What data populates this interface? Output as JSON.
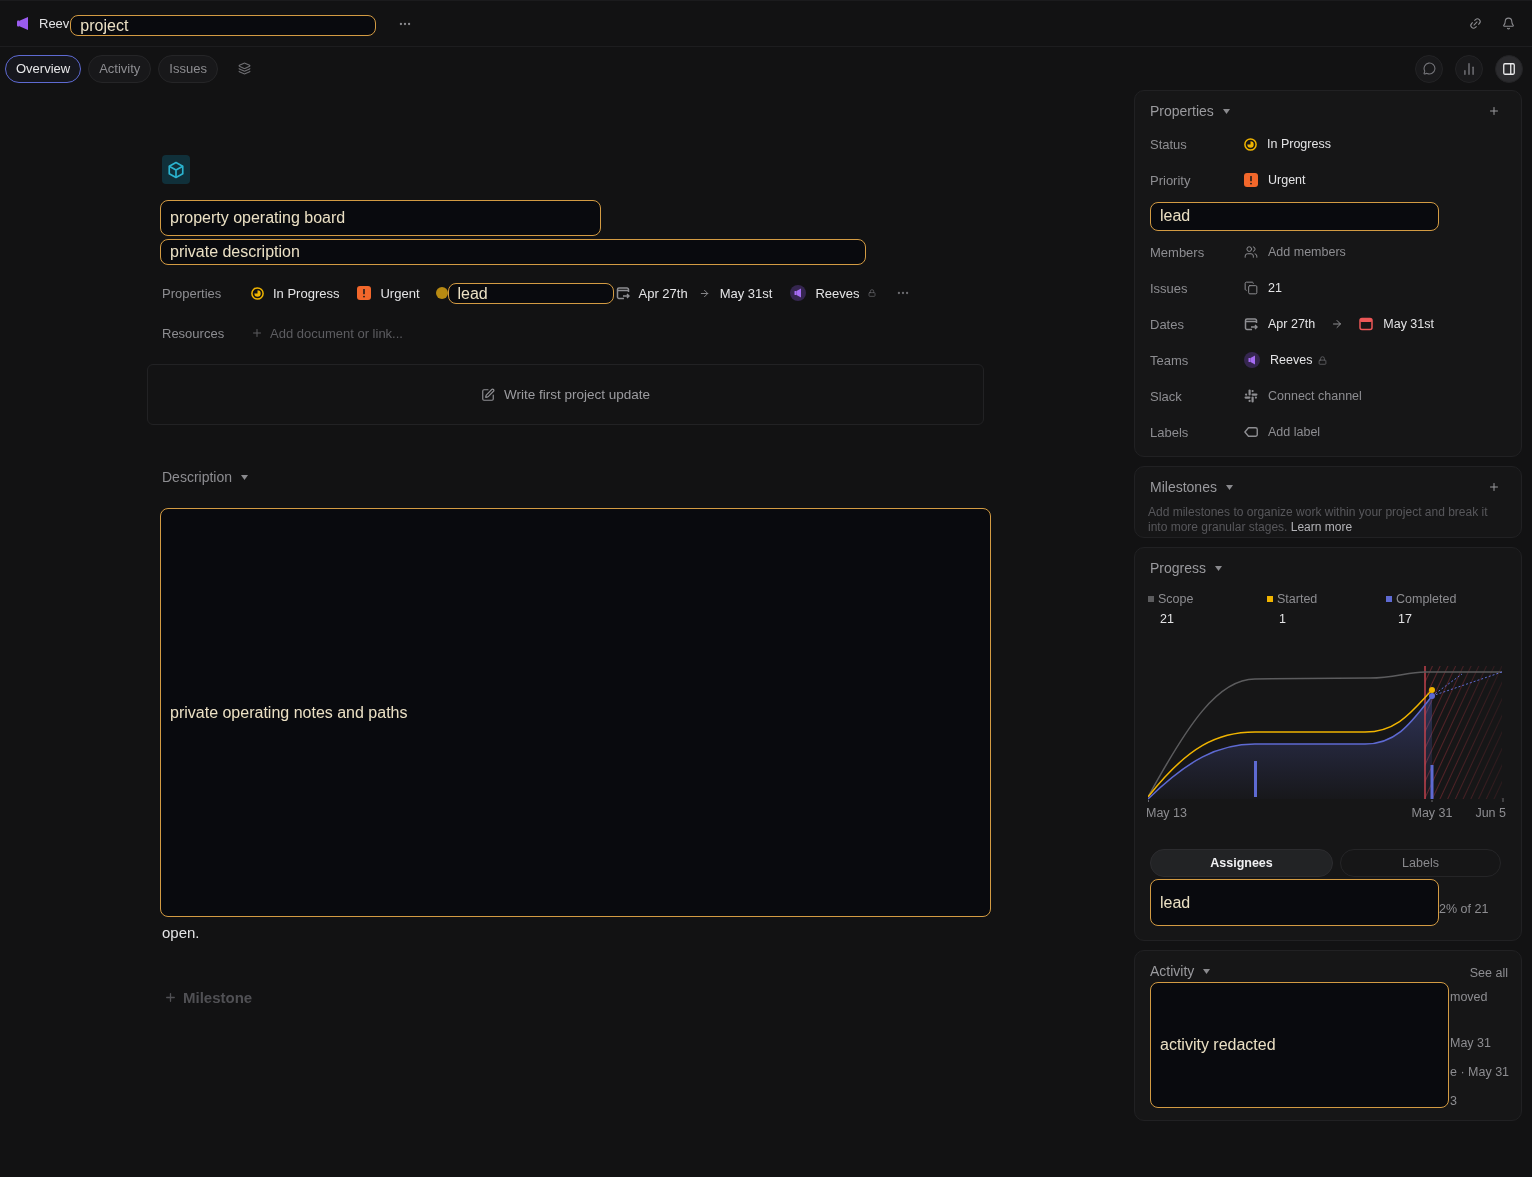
{
  "header": {
    "team": "Reev",
    "redaction": "project"
  },
  "view_tabs": [
    {
      "label": "Overview",
      "selected": true
    },
    {
      "label": "Activity",
      "selected": false
    },
    {
      "label": "Issues",
      "selected": false
    }
  ],
  "toolbar_buttons": [
    {
      "kind": "updates",
      "selected": false
    },
    {
      "kind": "insights",
      "selected": false
    },
    {
      "kind": "details",
      "selected": true
    }
  ],
  "project": {
    "title_redaction": "property operating board",
    "summary_redaction": "private description",
    "properties": {
      "label": "Properties",
      "status": "In Progress",
      "priority": "Urgent",
      "lead_redaction": "lead",
      "start_date": "Apr 27th",
      "target_date": "May 31st",
      "team": "Reeves",
      "private": true
    },
    "resources": {
      "label": "Resources",
      "add_link": "Add document or link..."
    },
    "update_prompt": "Write first project update",
    "description": {
      "heading": "Description",
      "redaction": "private operating notes and paths",
      "trailing_text": "open."
    },
    "add_milestone": "Milestone"
  },
  "sidebar": {
    "properties": {
      "title": "Properties",
      "rows": [
        {
          "kind": "status",
          "label": "Status",
          "value": "In Progress"
        },
        {
          "kind": "priority",
          "label": "Priority",
          "value": "Urgent"
        },
        {
          "kind": "lead",
          "value": "lead"
        },
        {
          "kind": "members",
          "label": "Members",
          "value": "Add members"
        },
        {
          "kind": "issues",
          "label": "Issues",
          "value": "21"
        },
        {
          "kind": "dates",
          "label": "Dates",
          "value": "Apr 27th",
          "end": "May 31st"
        },
        {
          "kind": "team",
          "label": "Teams",
          "value": "Reeves",
          "private": true
        },
        {
          "kind": "slack",
          "label": "Slack",
          "value": "Connect channel"
        },
        {
          "kind": "labels",
          "label": "Labels",
          "value": "Add label"
        }
      ]
    },
    "milestones": {
      "title": "Milestones",
      "hint": "Add milestones to organize work within your project and break it into more granular stages.",
      "link": "Learn more"
    },
    "progress": {
      "title": "Progress",
      "legend": [
        {
          "label": "Scope",
          "value": "21",
          "color": "#5c5c5e"
        },
        {
          "label": "Started",
          "value": "1",
          "color": "#f0b400"
        },
        {
          "label": "Completed",
          "value": "17",
          "color": "#5e6ad2"
        }
      ],
      "axis_labels": [
        "May 13",
        "May 31",
        "Jun 5"
      ],
      "tabs": [
        {
          "label": "Assignees",
          "selected": true
        },
        {
          "label": "Labels",
          "selected": false
        }
      ],
      "redaction": "lead",
      "share": "2% of 21"
    },
    "activity": {
      "title": "Activity",
      "see_all": "See all",
      "redaction": "activity redacted",
      "fragments": [
        "moved",
        "May 31",
        "e · May 31",
        "3"
      ]
    }
  }
}
